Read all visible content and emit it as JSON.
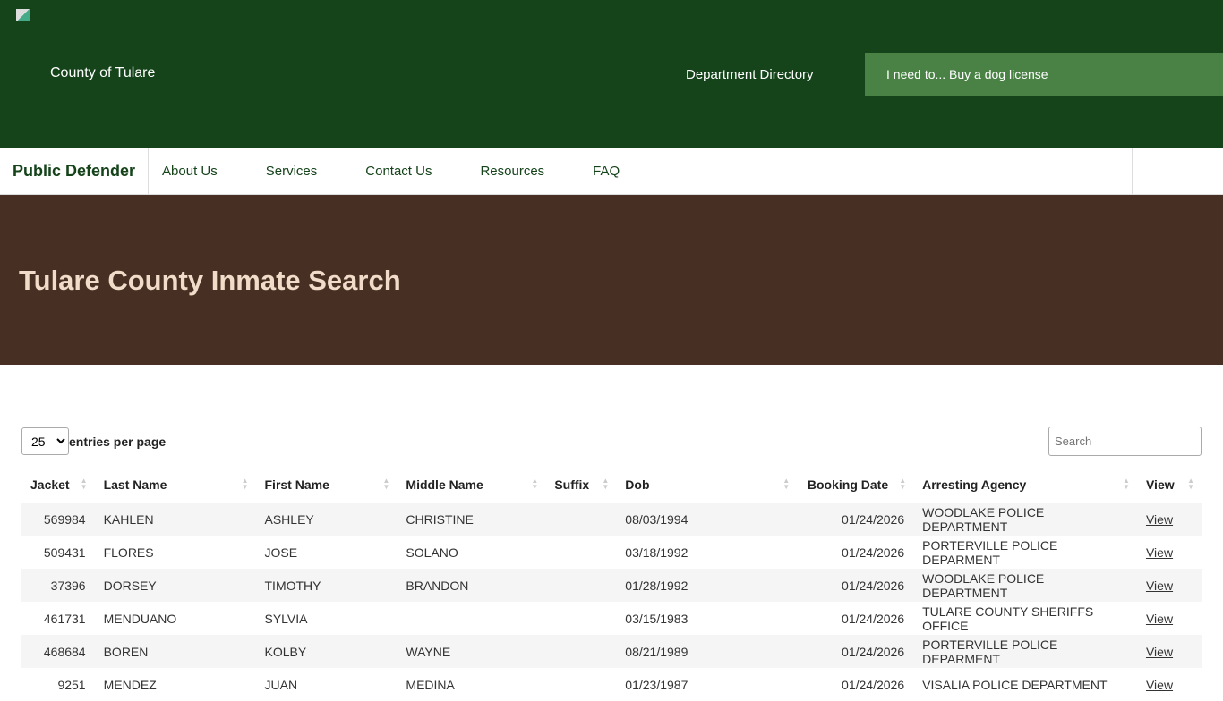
{
  "header": {
    "logo_alt": "County of Tulare logo",
    "county": "County of Tulare",
    "dept_directory": "Department Directory",
    "i_need": "I need to... Buy a dog license"
  },
  "nav": {
    "brand": "Public Defender",
    "items": [
      "About Us",
      "Services",
      "Contact Us",
      "Resources",
      "FAQ"
    ]
  },
  "hero": {
    "title": "Tulare County Inmate Search"
  },
  "controls": {
    "per_page": "25",
    "per_page_label": "entries per page",
    "search_placeholder": "Search"
  },
  "table": {
    "columns": [
      "Jacket",
      "Last Name",
      "First Name",
      "Middle Name",
      "Suffix",
      "Dob",
      "Booking Date",
      "Arresting Agency",
      "View"
    ],
    "rows": [
      [
        "569984",
        "KAHLEN",
        "ASHLEY",
        "CHRISTINE",
        "",
        "08/03/1994",
        "01/24/2026",
        "WOODLAKE POLICE DEPARTMENT",
        "View"
      ],
      [
        "509431",
        "FLORES",
        "JOSE",
        "SOLANO",
        "",
        "03/18/1992",
        "01/24/2026",
        "PORTERVILLE POLICE DEPARMENT",
        "View"
      ],
      [
        "37396",
        "DORSEY",
        "TIMOTHY",
        "BRANDON",
        "",
        "01/28/1992",
        "01/24/2026",
        "WOODLAKE POLICE DEPARTMENT",
        "View"
      ],
      [
        "461731",
        "MENDUANO",
        "SYLVIA",
        "",
        "",
        "03/15/1983",
        "01/24/2026",
        "TULARE COUNTY SHERIFFS OFFICE",
        "View"
      ],
      [
        "468684",
        "BOREN",
        "KOLBY",
        "WAYNE",
        "",
        "08/21/1989",
        "01/24/2026",
        "PORTERVILLE POLICE DEPARMENT",
        "View"
      ],
      [
        "9251",
        "MENDEZ",
        "JUAN",
        "MEDINA",
        "",
        "01/23/1987",
        "01/24/2026",
        "VISALIA POLICE DEPARTMENT",
        "View"
      ]
    ]
  }
}
